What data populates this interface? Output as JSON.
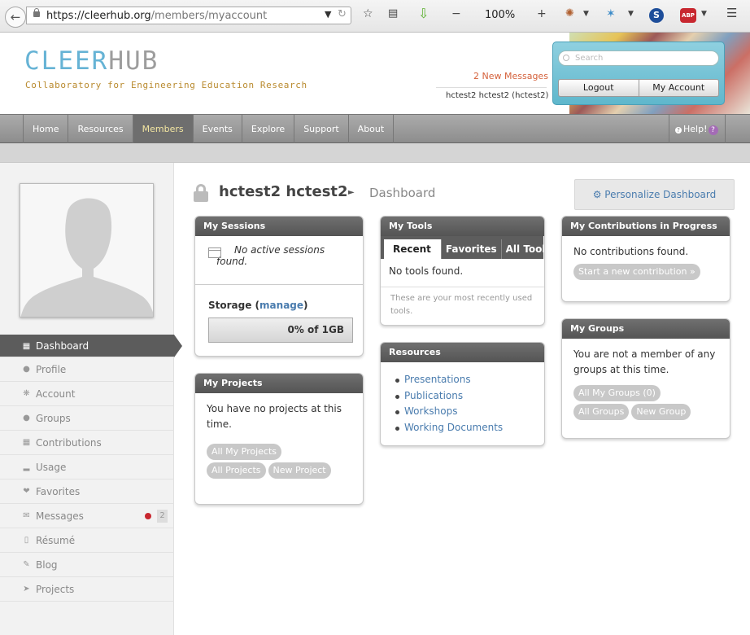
{
  "browser": {
    "url_host": "https://cleerhub.org",
    "url_path": "/members/myaccount",
    "zoom": "100%",
    "zoom_out": "−",
    "zoom_in": "+"
  },
  "header": {
    "logo_a": "CLEER",
    "logo_b": "HUB",
    "tagline": "Collaboratory for Engineering Education Research",
    "messages_link": "2 New Messages",
    "user_line": "hctest2 hctest2 (hctest2)",
    "search_placeholder": "Search",
    "logout": "Logout",
    "my_account": "My Account"
  },
  "nav": {
    "items": [
      "Home",
      "Resources",
      "Members",
      "Events",
      "Explore",
      "Support",
      "About"
    ],
    "active": "Members",
    "help": "Help!"
  },
  "sidebar": {
    "menu": [
      {
        "label": "Dashboard",
        "icon": "grid-icon"
      },
      {
        "label": "Profile",
        "icon": "person-icon"
      },
      {
        "label": "Account",
        "icon": "gears-icon"
      },
      {
        "label": "Groups",
        "icon": "group-icon"
      },
      {
        "label": "Contributions",
        "icon": "contributions-icon"
      },
      {
        "label": "Usage",
        "icon": "usage-icon"
      },
      {
        "label": "Favorites",
        "icon": "heart-icon"
      },
      {
        "label": "Messages",
        "icon": "envelope-icon"
      },
      {
        "label": "Résumé",
        "icon": "document-icon"
      },
      {
        "label": "Blog",
        "icon": "blog-icon"
      },
      {
        "label": "Projects",
        "icon": "send-icon"
      }
    ],
    "messages_count": "2"
  },
  "main": {
    "username": "hctest2 hctest2",
    "breadcrumb": "Dashboard",
    "personalize": "⚙ Personalize Dashboard"
  },
  "sessions": {
    "title": "My Sessions",
    "empty": "No active sessions found.",
    "storage_label": "Storage",
    "manage": "manage",
    "storage_value": "0% of 1GB"
  },
  "projects": {
    "title": "My Projects",
    "empty": "You have no projects at this time.",
    "btn_all_my": "All My Projects",
    "btn_all": "All Projects",
    "btn_new": "New Project"
  },
  "tools": {
    "title": "My Tools",
    "tabs": [
      "Recent",
      "Favorites",
      "All Tools"
    ],
    "empty": "No tools found.",
    "note": "These are your most recently used tools."
  },
  "resources": {
    "title": "Resources",
    "items": [
      "Presentations",
      "Publications",
      "Workshops",
      "Working Documents"
    ]
  },
  "contributions": {
    "title": "My Contributions in Progress",
    "empty": "No contributions found.",
    "btn_start": "Start a new contribution »"
  },
  "groups": {
    "title": "My Groups",
    "empty": "You are not a member of any groups at this time.",
    "btn_all_my": "All My Groups (0)",
    "btn_all": "All Groups",
    "btn_new": "New Group"
  }
}
